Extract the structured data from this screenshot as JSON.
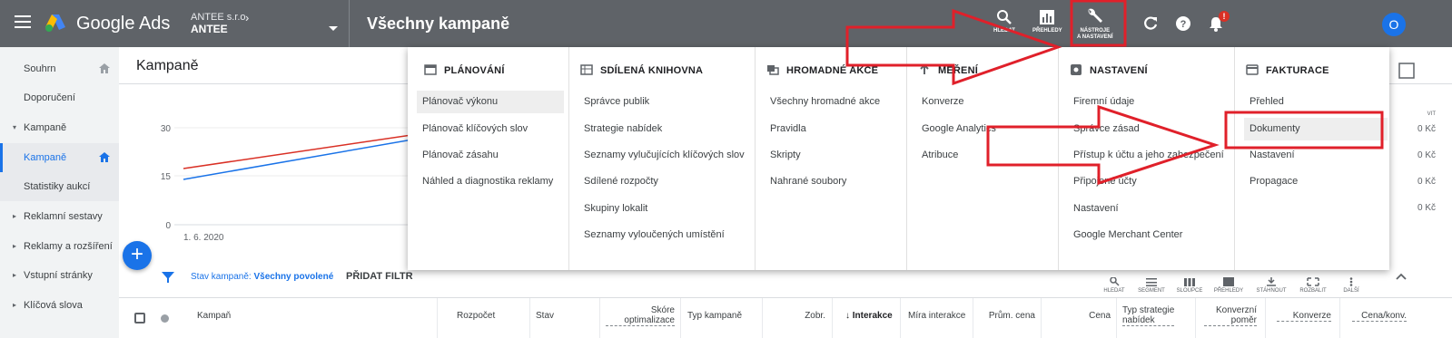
{
  "topbar": {
    "brand": "Google Ads",
    "account_company": "ANTEE s.r.o.",
    "account_name": "ANTEE",
    "page_title": "Všechny kampaně",
    "search_label": "HLEDAT",
    "reports_label": "PŘEHLEDY",
    "tools_label_1": "NÁSTROJE",
    "tools_label_2": "A NASTAVENÍ",
    "notification_badge": "!",
    "avatar_letter": "O"
  },
  "sidebar": {
    "items": [
      {
        "label": "Souhrn"
      },
      {
        "label": "Doporučení"
      },
      {
        "label": "Kampaně"
      },
      {
        "label": "Kampaně"
      },
      {
        "label": "Statistiky aukcí"
      },
      {
        "label": "Reklamní sestavy"
      },
      {
        "label": "Reklamy a rozšíření"
      },
      {
        "label": "Vstupní stránky"
      },
      {
        "label": "Klíčová slova"
      }
    ]
  },
  "main": {
    "title": "Kampaně",
    "chart_y_ticks": [
      "30",
      "15",
      "0"
    ],
    "chart_x_label": "1. 6. 2020",
    "filter_label": "Stav kampaně: ",
    "filter_value": "Všechny povolené",
    "add_filter": "PŘIDAT FILTR",
    "tools": [
      "HLEDAT",
      "SEGMENT",
      "SLOUPCE",
      "PŘEHLEDY",
      "STÁHNOUT",
      "ROZBALIT",
      "DALŠÍ"
    ],
    "right_values": [
      "0 Kč",
      "0 Kč",
      "0 Kč",
      "0 Kč"
    ],
    "right_label": "VIT"
  },
  "table_headers": {
    "campaign": "Kampaň",
    "budget": "Rozpočet",
    "status": "Stav",
    "score_1": "Skóre",
    "score_2": "optimalizace",
    "type": "Typ kampaně",
    "impr": "Zobr.",
    "interactions": "Interakce",
    "interaction_rate": "Míra interakce",
    "avg_cost": "Prům. cena",
    "cost": "Cena",
    "bid_type_1": "Typ strategie",
    "bid_type_2": "nabídek",
    "conv_rate_1": "Konverzní",
    "conv_rate_2": "poměr",
    "conversions": "Konverze",
    "cost_conv": "Cena/konv."
  },
  "dropdown": {
    "columns": [
      {
        "title": "PLÁNOVÁNÍ",
        "items": [
          "Plánovač výkonu",
          "Plánovač klíčových slov",
          "Plánovač zásahu",
          "Náhled a diagnostika reklamy"
        ]
      },
      {
        "title": "SDÍLENÁ KNIHOVNA",
        "items": [
          "Správce publik",
          "Strategie nabídek",
          "Seznamy vylučujících klíčových slov",
          "Sdílené rozpočty",
          "Skupiny lokalit",
          "Seznamy vyloučených umístění"
        ]
      },
      {
        "title": "HROMADNÉ AKCE",
        "items": [
          "Všechny hromadné akce",
          "Pravidla",
          "Skripty",
          "Nahrané soubory"
        ]
      },
      {
        "title": "MĚŘENÍ",
        "items": [
          "Konverze",
          "Google Analytics",
          "Atribuce"
        ]
      },
      {
        "title": "NASTAVENÍ",
        "items": [
          "Firemní údaje",
          "Správce zásad",
          "Přístup k účtu a jeho zabezpečení",
          "Připojené účty",
          "Nastavení",
          "Google Merchant Center"
        ]
      },
      {
        "title": "FAKTURACE",
        "items": [
          "Přehled",
          "Dokumenty",
          "Nastavení",
          "Propagace"
        ]
      }
    ]
  },
  "colors": {
    "topbar": "#5f6368",
    "accent": "#1a73e8",
    "annotation_red": "#e0202a"
  }
}
